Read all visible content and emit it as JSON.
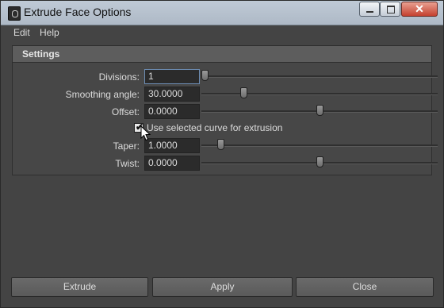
{
  "window": {
    "title": "Extrude Face Options",
    "controls": {
      "minimize": "▁",
      "maximize": "▢",
      "close": "✕"
    }
  },
  "menu": {
    "items": [
      "Edit",
      "Help"
    ]
  },
  "settings": {
    "title": "Settings",
    "fields": [
      {
        "label": "Divisions:",
        "value": "1",
        "slider_fraction": 0.0
      },
      {
        "label": "Smoothing angle:",
        "value": "30.0000",
        "slider_fraction": 0.17
      },
      {
        "label": "Offset:",
        "value": "0.0000",
        "slider_fraction": 0.5
      },
      {
        "label": "Taper:",
        "value": "1.0000",
        "slider_fraction": 0.07
      },
      {
        "label": "Twist:",
        "value": "0.0000",
        "slider_fraction": 0.5
      }
    ],
    "checkbox": {
      "label": "Use selected curve for extrusion",
      "checked": true
    }
  },
  "buttons": {
    "extrude": "Extrude",
    "apply": "Apply",
    "close": "Close"
  }
}
